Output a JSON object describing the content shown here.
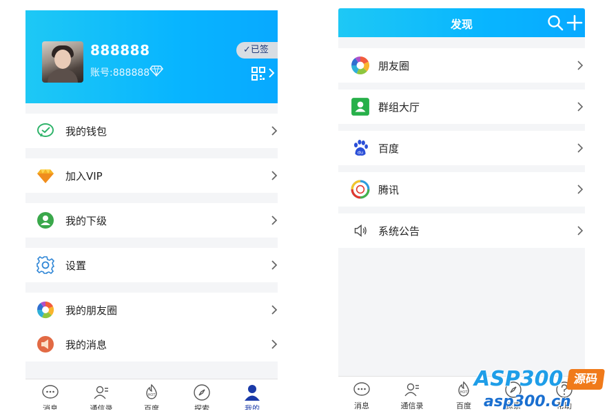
{
  "left": {
    "profile": {
      "username": "888888",
      "account": "账号:888888",
      "signin_label": "✓已签"
    },
    "menu": [
      {
        "label": "我的钱包",
        "icon": "wallet-icon"
      },
      {
        "label": "加入VIP",
        "icon": "vip-diamond-icon"
      },
      {
        "label": "我的下级",
        "icon": "subordinate-user-icon"
      },
      {
        "label": "设置",
        "icon": "gear-icon"
      },
      {
        "label": "我的朋友圈",
        "icon": "moments-aperture-icon"
      },
      {
        "label": "我的消息",
        "icon": "message-icon"
      }
    ],
    "tabs": [
      {
        "label": "消息",
        "icon": "chat-bubble-icon"
      },
      {
        "label": "通信录",
        "icon": "contacts-icon"
      },
      {
        "label": "百度",
        "icon": "hot-icon"
      },
      {
        "label": "探索",
        "icon": "compass-icon"
      },
      {
        "label": "我的",
        "icon": "person-icon",
        "active": true
      }
    ]
  },
  "right": {
    "title": "发现",
    "menu": [
      {
        "label": "朋友圈",
        "icon": "moments-aperture-icon"
      },
      {
        "label": "群组大厅",
        "icon": "group-hall-icon"
      },
      {
        "label": "百度",
        "icon": "baidu-paw-icon"
      },
      {
        "label": "腾讯",
        "icon": "tencent-icon"
      },
      {
        "label": "系统公告",
        "icon": "speaker-icon"
      }
    ],
    "tabs": [
      {
        "label": "消息",
        "icon": "chat-bubble-icon"
      },
      {
        "label": "通信录",
        "icon": "contacts-icon"
      },
      {
        "label": "百度",
        "icon": "hot-icon"
      },
      {
        "label": "探索",
        "icon": "compass-icon"
      },
      {
        "label": "帮助",
        "icon": "help-icon"
      }
    ]
  },
  "watermark": {
    "brand": "ASP300",
    "badge": "源码",
    "url": "asp300.cn"
  },
  "colors": {
    "header_gradient_start": "#1ec8f5",
    "header_gradient_end": "#08a9ff",
    "active_tab": "#1a3aa8",
    "watermark_orange": "#f07a1a",
    "watermark_blue": "#1f9ee8"
  }
}
